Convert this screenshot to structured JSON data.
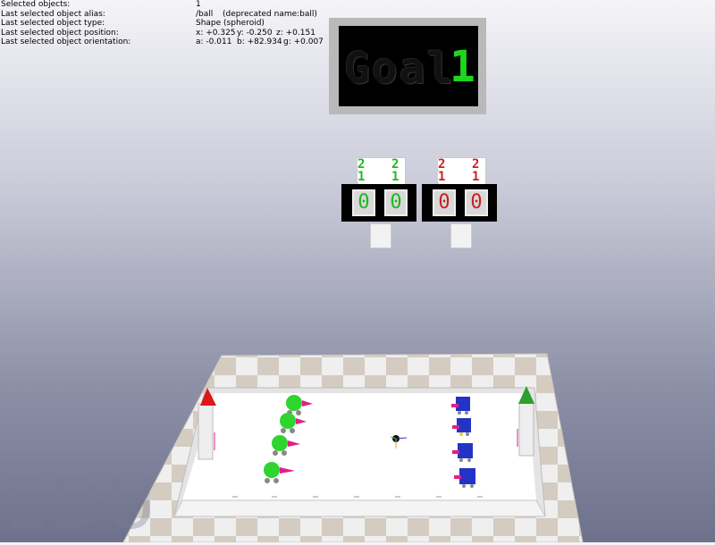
{
  "info": {
    "selected_objects_label": "Selected objects:",
    "selected_objects_value": "1",
    "alias_label": "Last selected object alias:",
    "alias_value": "/ball",
    "alias_deprecated": "(deprecated name:ball)",
    "type_label": "Last selected object type:",
    "type_value": "Shape (spheroid)",
    "position_label": "Last selected object position:",
    "position_x": "x: +0.325",
    "position_y": "y: -0.250",
    "position_z": "z: +0.151",
    "orientation_label": "Last selected object orientation:",
    "orientation_a": "a: -0.011",
    "orientation_b": "b: +82.934",
    "orientation_g": "g: +0.007"
  },
  "scoreboard": {
    "goal_text": "Goal",
    "goal_digit": "1"
  },
  "scorers": {
    "green": {
      "flip_top": "2",
      "flip_bottom": "1",
      "left": "0",
      "right": "0",
      "color": "#1fb81f"
    },
    "red": {
      "flip_top": "2",
      "flip_bottom": "1",
      "left": "0",
      "right": "0",
      "color": "#cc1f1f"
    }
  },
  "watermark": "EDU",
  "colors": {
    "green_team": "#2fd42f",
    "blue_team": "#2333c8",
    "field": "#ffffff",
    "floor_light": "#eeeeee",
    "floor_dark": "#cfc7bc"
  }
}
